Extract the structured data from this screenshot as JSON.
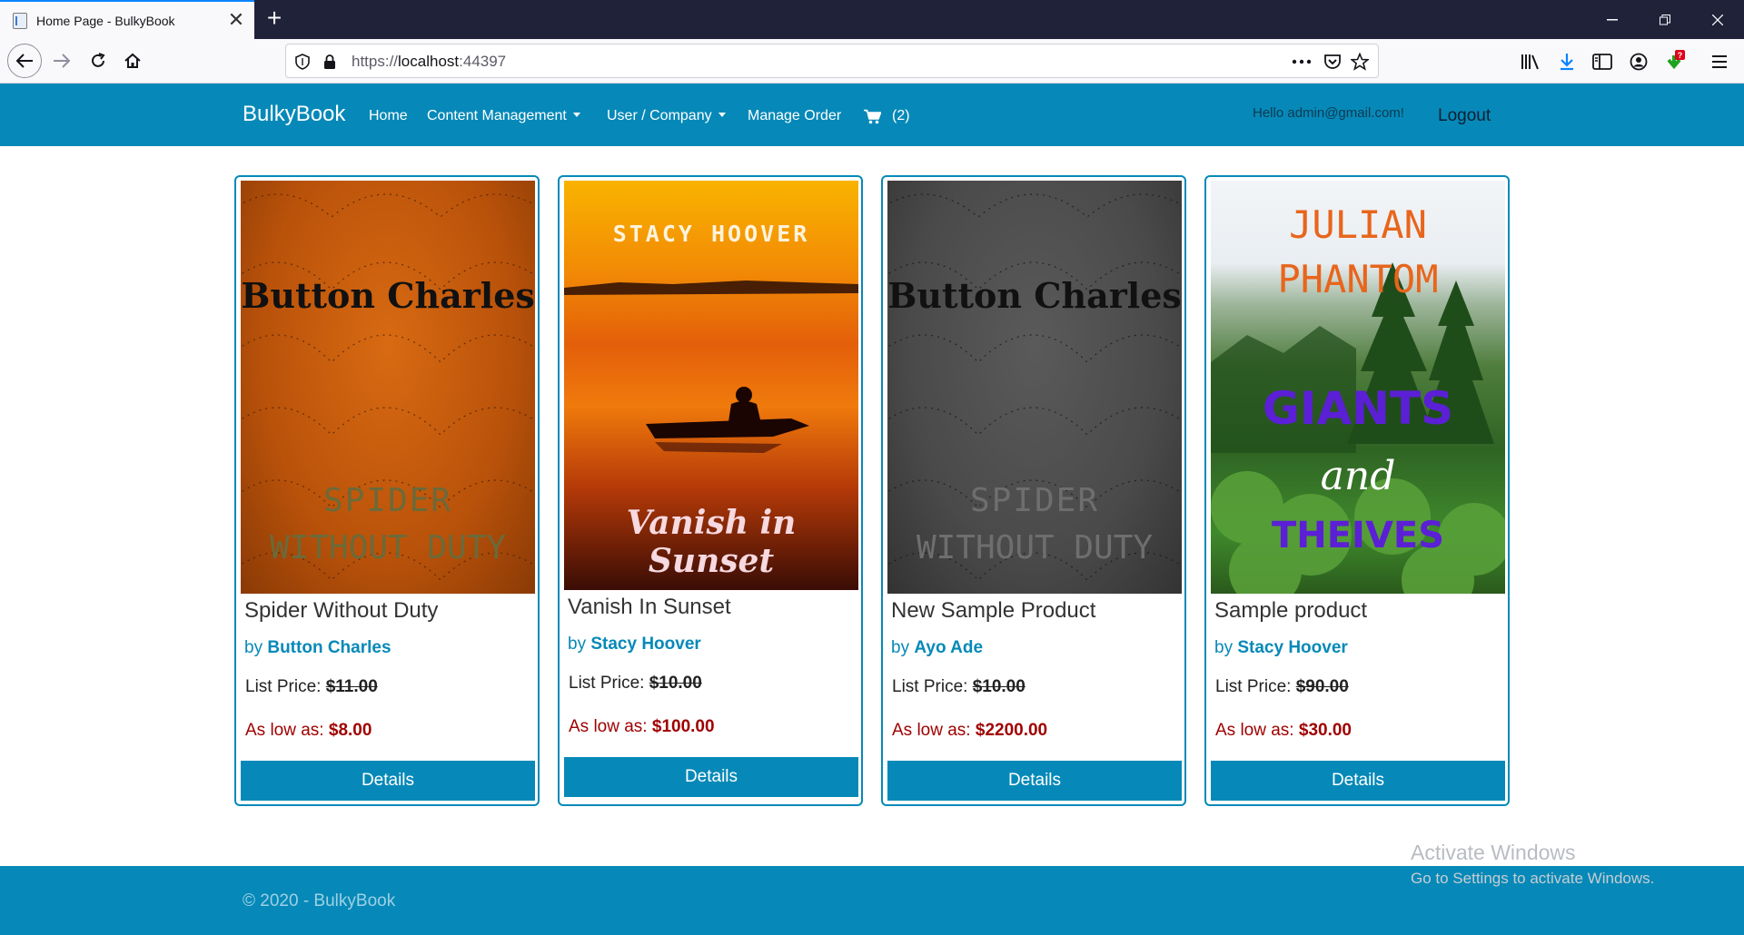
{
  "browser": {
    "tab_title": "Home Page - BulkyBook",
    "url_prefix": "https://",
    "url_host": "localhost",
    "url_port": ":44397",
    "download_badge": "?"
  },
  "nav": {
    "brand": "BulkyBook",
    "home": "Home",
    "content_management": "Content Management",
    "user_company": "User / Company",
    "manage_order": "Manage Order",
    "cart_count": "(2)",
    "hello": "Hello admin@gmail.com!",
    "logout": "Logout"
  },
  "products": [
    {
      "title": "Spider Without Duty",
      "by": "by",
      "author": "Button Charles",
      "list_label": "List Price:",
      "list_price": "$11.00",
      "low_label": "As low as:",
      "low_price": "$8.00",
      "details": "Details",
      "cover": {
        "author_text": "Button Charles",
        "title_line1": "SPIDER",
        "title_line2": "WITHOUT DUTY",
        "bg": "#c9580a"
      }
    },
    {
      "title": "Vanish In Sunset",
      "by": "by",
      "author": "Stacy Hoover",
      "list_label": "List Price:",
      "list_price": "$10.00",
      "low_label": "As low as:",
      "low_price": "$100.00",
      "details": "Details",
      "cover": {
        "author_text": "STACY HOOVER",
        "title_text": "Vanish in Sunset",
        "bg": "#f07a0c"
      }
    },
    {
      "title": "New Sample Product",
      "by": "by",
      "author": "Ayo Ade",
      "list_label": "List Price:",
      "list_price": "$10.00",
      "low_label": "As low as:",
      "low_price": "$2200.00",
      "details": "Details",
      "cover": {
        "author_text": "Button Charles",
        "title_line1": "SPIDER",
        "title_line2": "WITHOUT DUTY",
        "bg": "#4a4a4a"
      }
    },
    {
      "title": "Sample product",
      "by": "by",
      "author": "Stacy Hoover",
      "list_label": "List Price:",
      "list_price": "$90.00",
      "low_label": "As low as:",
      "low_price": "$30.00",
      "details": "Details",
      "cover": {
        "author_line1": "JULIAN",
        "author_line2": "PHANTOM",
        "title_line1": "GIANTS",
        "title_line2": "and",
        "title_line3": "THEIVES",
        "bg": "#3f7a2a"
      }
    }
  ],
  "footer": {
    "copyright": "© 2020 - BulkyBook"
  },
  "watermark": {
    "line1": "Activate Windows",
    "line2": "Go to Settings to activate Windows."
  },
  "colors": {
    "primary": "#0689b8",
    "price_red": "#a00000",
    "chrome_dark": "#1f2239"
  }
}
